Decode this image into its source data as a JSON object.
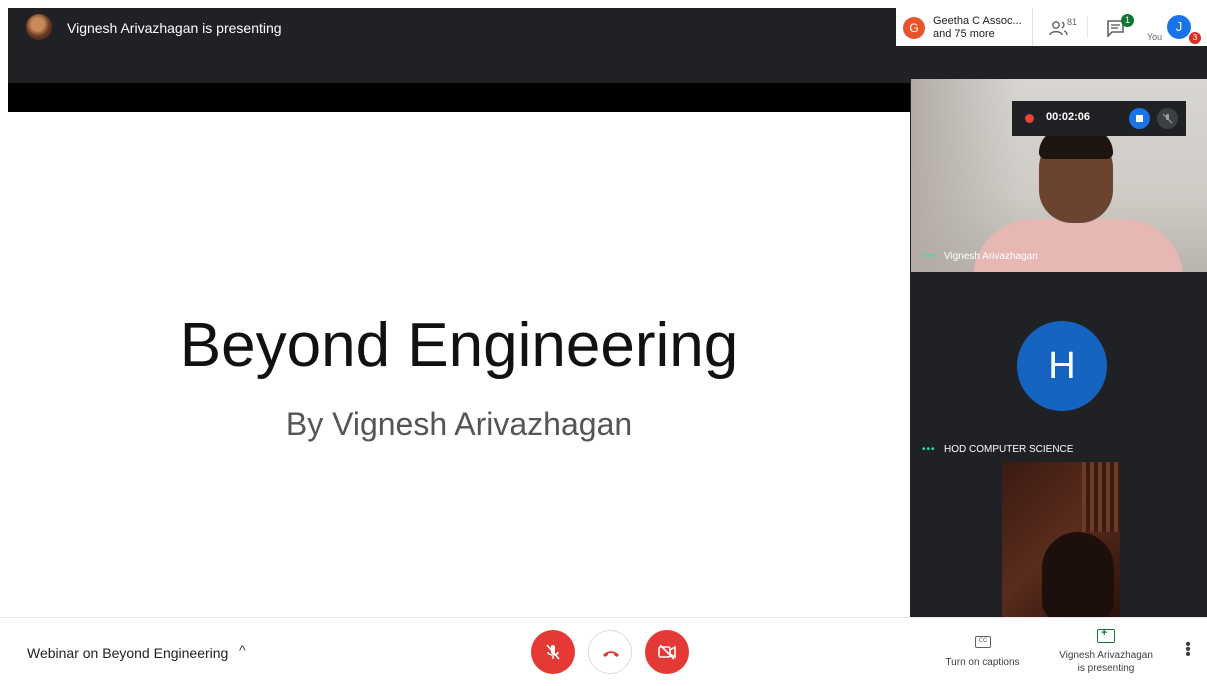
{
  "top_bar": {
    "presenting_text": "Vignesh Arivazhagan is presenting",
    "participant_preview_initial": "G",
    "participant_preview_name": "Geetha C Assoc...",
    "participant_preview_more": "and 75 more",
    "people_count": "81",
    "chat_badge": "1",
    "you_label": "You",
    "self_initial": "J",
    "self_badge": "3"
  },
  "slide": {
    "title": "Beyond Engineering",
    "subtitle": "By Vignesh Arivazhagan"
  },
  "recording": {
    "time": "00:02:06",
    "icons": [
      "record-dot",
      "stop",
      "mic-off"
    ]
  },
  "tiles": [
    {
      "name": "Vignesh Arivazhagan"
    },
    {
      "name": "HOD COMPUTER SCIENCE",
      "initial": "H"
    }
  ],
  "bottom_bar": {
    "meeting_title": "Webinar on Beyond Engineering",
    "captions_label": "Turn on captions",
    "presenting_label_line1": "Vignesh Arivazhagan",
    "presenting_label_line2": "is presenting"
  },
  "colors": {
    "mic_off": "#e53935",
    "cam_off": "#e53935",
    "hangup": "#e53935",
    "accent_blue": "#1a73e8",
    "chat_badge": "#137333"
  }
}
